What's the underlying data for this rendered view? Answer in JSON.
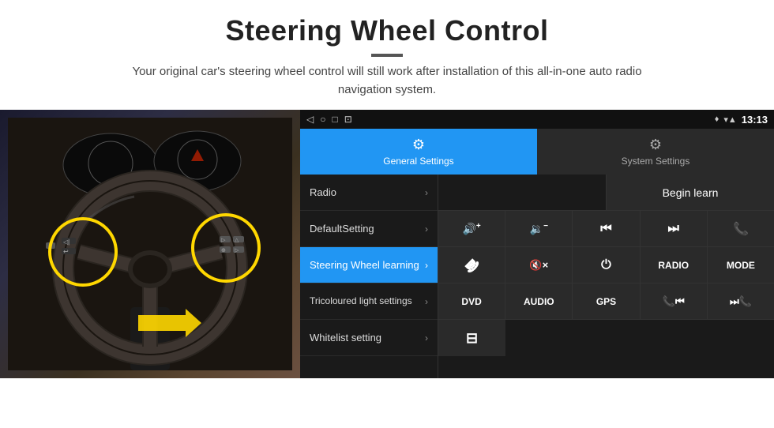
{
  "header": {
    "title": "Steering Wheel Control",
    "subtitle": "Your original car's steering wheel control will still work after installation of this all-in-one auto radio navigation system."
  },
  "status_bar": {
    "nav_back": "◁",
    "nav_home": "○",
    "nav_recent": "□",
    "nav_extra": "⊡",
    "signal": "▾▲",
    "wifi": "▾",
    "time": "13:13"
  },
  "tabs": [
    {
      "id": "general",
      "label": "General Settings",
      "active": true
    },
    {
      "id": "system",
      "label": "System Settings",
      "active": false
    }
  ],
  "menu_items": [
    {
      "id": "radio",
      "label": "Radio",
      "active": false
    },
    {
      "id": "default",
      "label": "DefaultSetting",
      "active": false
    },
    {
      "id": "steering",
      "label": "Steering Wheel learning",
      "active": true
    },
    {
      "id": "tricolour",
      "label": "Tricoloured light settings",
      "active": false
    },
    {
      "id": "whitelist",
      "label": "Whitelist setting",
      "active": false
    }
  ],
  "controls": {
    "begin_learn": "Begin learn",
    "row1": [
      {
        "id": "vol-up",
        "label": "🔊+",
        "sym": "vol+"
      },
      {
        "id": "vol-down",
        "label": "🔉−",
        "sym": "vol-"
      },
      {
        "id": "prev-track",
        "label": "⏮",
        "sym": "prev"
      },
      {
        "id": "next-track",
        "label": "⏭",
        "sym": "next"
      },
      {
        "id": "phone",
        "label": "📞",
        "sym": "phone"
      }
    ],
    "row2": [
      {
        "id": "hang-up",
        "label": "↩",
        "sym": "hangup"
      },
      {
        "id": "mute",
        "label": "🔇×",
        "sym": "mute"
      },
      {
        "id": "power",
        "label": "⏻",
        "sym": "power"
      },
      {
        "id": "radio-btn",
        "label": "RADIO",
        "sym": "RADIO"
      },
      {
        "id": "mode-btn",
        "label": "MODE",
        "sym": "MODE"
      }
    ],
    "row3": [
      {
        "id": "dvd-btn",
        "label": "DVD",
        "sym": "DVD"
      },
      {
        "id": "audio-btn",
        "label": "AUDIO",
        "sym": "AUDIO"
      },
      {
        "id": "gps-btn",
        "label": "GPS",
        "sym": "GPS"
      },
      {
        "id": "prev-seek",
        "label": "📞⏮",
        "sym": "prev2"
      },
      {
        "id": "next-seek",
        "label": "⏭📞",
        "sym": "next2"
      }
    ],
    "row4": [
      {
        "id": "eq-btn",
        "label": "≡",
        "sym": "eq"
      }
    ]
  }
}
